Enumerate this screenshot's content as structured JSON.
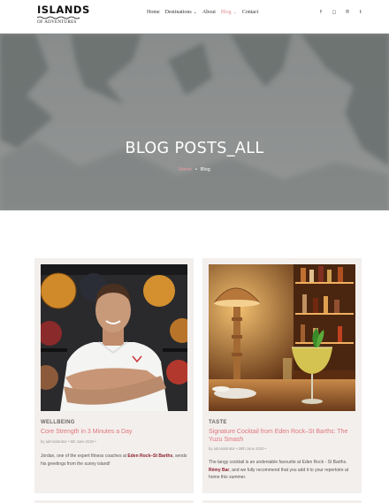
{
  "header": {
    "logo": {
      "name": "ISLANDS",
      "tagline": "OF ADVENTURES"
    },
    "nav": [
      {
        "label": "Home",
        "dropdown": false
      },
      {
        "label": "Destinations",
        "dropdown": true
      },
      {
        "label": "About",
        "dropdown": false
      },
      {
        "label": "Blog",
        "dropdown": true,
        "active": true
      },
      {
        "label": "Contact",
        "dropdown": false
      }
    ],
    "social": [
      {
        "icon": "facebook-icon",
        "glyph": "f"
      },
      {
        "icon": "instagram-icon",
        "glyph": "◻"
      },
      {
        "icon": "pinterest-icon",
        "glyph": "℗"
      },
      {
        "icon": "tumblr-icon",
        "glyph": "t"
      }
    ]
  },
  "hero": {
    "title": "BLOG POSTS_ALL",
    "breadcrumb": {
      "home": "Home",
      "separator": "•",
      "current": "Blog"
    }
  },
  "posts": [
    {
      "category": "WELLBEING",
      "title": "Core Strength in 3 Minutes a Day",
      "meta": "by administrator   •   5th June 2020   •",
      "excerpt_before": "Jordan, one of the expert fitness coaches at ",
      "excerpt_link_1": "Eden Rock–St Barths",
      "excerpt_after": ", sends his greetings from the sunny island!",
      "image": "fitness-coach-photo"
    },
    {
      "category": "TASTE",
      "title": "Signature Cocktail from Eden Rock–St Barths: The Yuzu Smash",
      "meta": "by administrator   •   26th June 2020   •",
      "excerpt_before": "The tangy cocktail is an undeniable favourite at Eden Rock - St Barths. ",
      "excerpt_link_1": "Rémy Bar",
      "excerpt_after": ", and we fully recommend that you add it to your repertoire at home this summer.",
      "image": "cocktail-photo"
    }
  ],
  "colors": {
    "accent": "#e0757c",
    "link_dark": "#8a1f2b",
    "card_bg": "#f3efed"
  }
}
